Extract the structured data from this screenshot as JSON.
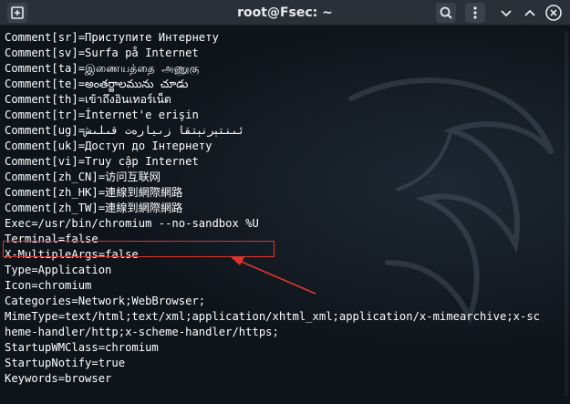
{
  "window": {
    "title": "root@Fsec: ~"
  },
  "terminal_lines": [
    "Comment[sr]=Приступите Интернету",
    "Comment[sv]=Surfa på Internet",
    "Comment[ta]=இணையத்தை அணுகு",
    "Comment[te]=అంతర్జాలమును చూడు",
    "Comment[th]=เข้าถึงอินเทอร์เน็ต",
    "Comment[tr]=İnternet'e erişin",
    "Comment[ug]=ئىنتېرنېتقا زىيارەت قىلىش",
    "Comment[uk]=Доступ до Інтернету",
    "Comment[vi]=Truy cập Internet",
    "Comment[zh_CN]=访问互联网",
    "Comment[zh_HK]=連線到網際網路",
    "Comment[zh_TW]=連線到網際網路",
    "Exec=/usr/bin/chromium --no-sandbox %U",
    "Terminal=false",
    "X-MultipleArgs=false",
    "Type=Application",
    "Icon=chromium",
    "Categories=Network;WebBrowser;",
    "MimeType=text/html;text/xml;application/xhtml_xml;application/x-mimearchive;x-sc",
    "heme-handler/http;x-scheme-handler/https;",
    "StartupWMClass=chromium",
    "StartupNotify=true",
    "Keywords=browser"
  ],
  "colors": {
    "highlight": "#e0342f",
    "arrow": "#e0342f",
    "text": "#ffffff"
  },
  "icons": {
    "new_tab": "new-tab-icon",
    "search": "search-icon",
    "menu": "menu-icon",
    "minimize": "minimize-icon",
    "maximize": "maximize-icon",
    "close": "close-icon"
  }
}
